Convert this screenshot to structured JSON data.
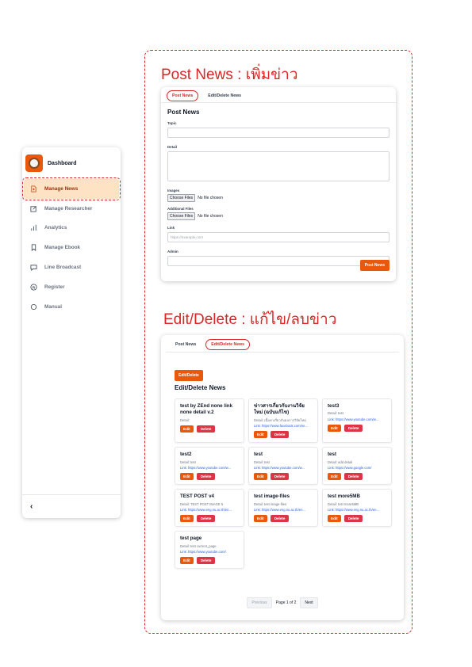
{
  "sidebar": {
    "title": "Dashboard",
    "items": [
      {
        "label": "Manage News",
        "icon": "file-plus-icon",
        "active": true
      },
      {
        "label": "Manage Researcher",
        "icon": "edit-icon"
      },
      {
        "label": "Analytics",
        "icon": "bar-chart-icon"
      },
      {
        "label": "Manage Ebook",
        "icon": "bookmark-icon"
      },
      {
        "label": "Line Broadcast",
        "icon": "chat-icon"
      },
      {
        "label": "Register",
        "icon": "registered-icon"
      },
      {
        "label": "Manual",
        "icon": "circle-icon"
      }
    ],
    "collapse_glyph": "‹"
  },
  "section1": {
    "title": "Post News : เพิ่มข่าว"
  },
  "section2": {
    "title": "Edit/Delete : แก้ไข/ลบข่าว"
  },
  "post_card": {
    "tabs": [
      "Post News",
      "Edit/Delete News"
    ],
    "heading": "Post News",
    "topic_label": "Topic",
    "detail_label": "Detail",
    "images_label": "Images",
    "additional_label": "Additional Files",
    "choose_files": "Choose Files",
    "no_file": "No file chosen",
    "link_label": "Link",
    "link_placeholder": "https://example.com",
    "admin_label": "Admin",
    "submit": "Post News"
  },
  "edit_card": {
    "tabs": [
      "Post News",
      "Edit/Delete News"
    ],
    "top_button": "Edit/Delete",
    "heading": "Edit/Delete News",
    "edit_label": "Edit",
    "delete_label": "Delete",
    "news": [
      {
        "title": "test by ZEnd none link none detail v.2",
        "detail": "Detail:",
        "link": ""
      },
      {
        "title": "ข่าวสารเกี่ยวกับงานวิจัยใหม่ (ฉบับแก้ไข)",
        "detail": "Detail: เนื้อหาเกี่ยวกับผลการวิจัยใหม่",
        "link": "Link: https://www.facebook.com/ne..."
      },
      {
        "title": "test3",
        "detail": "Detail: test",
        "link": "Link: https://www.youtube.com/w..."
      },
      {
        "title": "test2",
        "detail": "Detail: test",
        "link": "Link: https://www.youtube.com/w..."
      },
      {
        "title": "test",
        "detail": "Detail: test",
        "link": "Link: https://www.youtube.com/w..."
      },
      {
        "title": "test",
        "detail": "Detail: add detail",
        "link": "Link: https://www.google.com/"
      },
      {
        "title": "TEST POST v4",
        "detail": "Detail: TEST POST IMAGE 5",
        "link": "Link: https://www.eng.nu.ac.th/en..."
      },
      {
        "title": "test image-files",
        "detail": "Detail: test image-files",
        "link": "Link: https://www.eng.nu.ac.th/en..."
      },
      {
        "title": "test more5MB",
        "detail": "Detail: test more5MB",
        "link": "Link: https://www.eng.nu.ac.th/en..."
      },
      {
        "title": "test page",
        "detail": "Detail: test current_page",
        "link": "Link: https://www.youtube.com/"
      }
    ],
    "pager": {
      "prev": "Previous",
      "label": "Page 1 of 2",
      "next": "Next"
    }
  },
  "colors": {
    "accent": "#e8590c",
    "danger": "#dc3545",
    "annotation": "#dc2626"
  }
}
